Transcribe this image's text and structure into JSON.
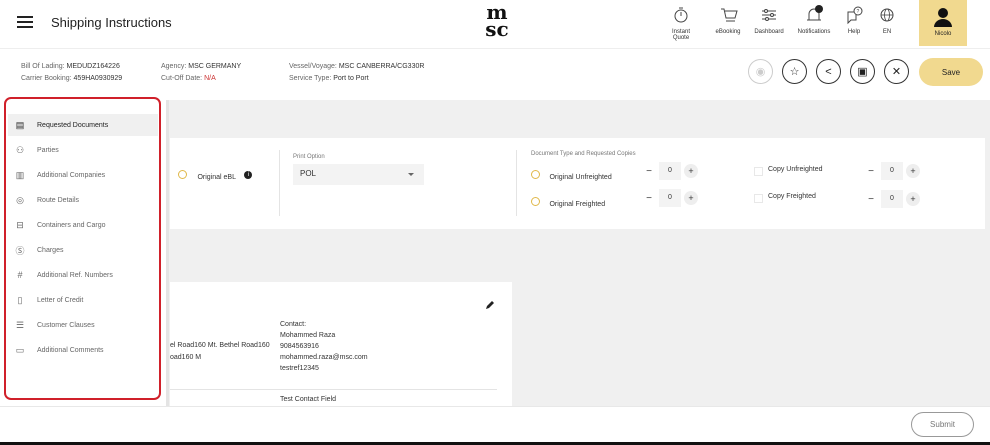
{
  "header": {
    "title": "Shipping Instructions",
    "logo_top": "m",
    "logo_bottom": "sc",
    "nav": [
      {
        "label": "Instant Quote",
        "icon": "stopwatch-icon"
      },
      {
        "label": "eBooking",
        "icon": "cart-icon"
      },
      {
        "label": "Dashboard",
        "icon": "sliders-icon"
      },
      {
        "label": "Notifications",
        "icon": "bell-icon",
        "badge": "99+"
      },
      {
        "label": "Help",
        "icon": "help-chat-icon"
      },
      {
        "label": "EN",
        "icon": "globe-icon"
      }
    ],
    "user": {
      "name": "Nicolo",
      "icon": "user-icon"
    }
  },
  "info": {
    "bill_of_lading_label": "Bill Of Lading:",
    "bill_of_lading": "MEDUDZ164226",
    "carrier_booking_label": "Carrier Booking:",
    "carrier_booking": "459HA0930929",
    "agency_label": "Agency:",
    "agency": "MSC GERMANY",
    "cutoff_label": "Cut-Off Date:",
    "cutoff": "N/A",
    "vessel_label": "Vessel/Voyage:",
    "vessel": "MSC CANBERRA/CG330R",
    "service_label": "Service Type:",
    "service": "Port to Port"
  },
  "actions": {
    "save_label": "Save",
    "icons": [
      "eye-icon",
      "star-icon",
      "share-icon",
      "document-icon",
      "close-icon"
    ]
  },
  "sidebar": {
    "items": [
      {
        "label": "Requested Documents",
        "icon": "documents-icon",
        "active": true
      },
      {
        "label": "Parties",
        "icon": "people-icon"
      },
      {
        "label": "Additional Companies",
        "icon": "building-icon"
      },
      {
        "label": "Route Details",
        "icon": "location-pin-icon"
      },
      {
        "label": "Containers and Cargo",
        "icon": "container-icon"
      },
      {
        "label": "Charges",
        "icon": "dollar-icon"
      },
      {
        "label": "Additional Ref. Numbers",
        "icon": "hash-icon"
      },
      {
        "label": "Letter of Credit",
        "icon": "page-icon"
      },
      {
        "label": "Customer Clauses",
        "icon": "clauses-icon"
      },
      {
        "label": "Additional Comments",
        "icon": "comment-icon"
      }
    ]
  },
  "documents": {
    "original_ebl": "Original eBL",
    "print_option_label": "Print Option",
    "print_option_value": "POL",
    "doc_type_label": "Document Type and Requested Copies",
    "original_unfreighted": "Original Unfreighted",
    "original_freighted": "Original Freighted",
    "copy_unfreighted": "Copy Unfreighted",
    "copy_freighted": "Copy Freighted",
    "qty_original_unfreighted": "0",
    "qty_original_freighted": "0",
    "qty_copy_unfreighted": "0",
    "qty_copy_freighted": "0"
  },
  "party": {
    "address_line1": "el Road160 Mt. Bethel Road160",
    "address_line2": "oad160 M",
    "contact_label": "Contact:",
    "contact_name": "Mohammed Raza",
    "contact_phone": "9084563916",
    "contact_email": "mohammed.raza@msc.com",
    "contact_ref": "testref12345",
    "test_contact_field": "Test Contact Field"
  },
  "footer": {
    "submit_label": "Submit"
  }
}
